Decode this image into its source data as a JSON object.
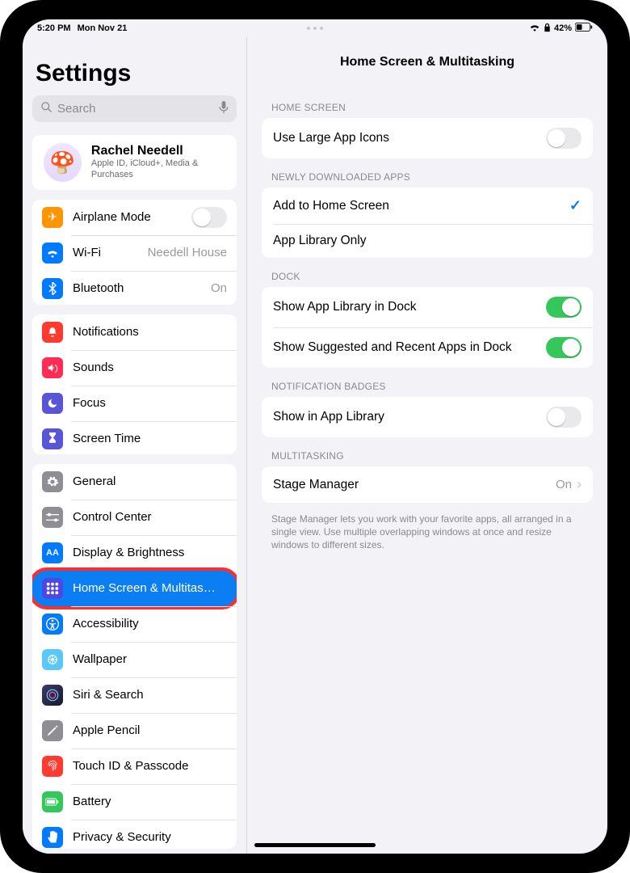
{
  "status": {
    "time": "5:20 PM",
    "date": "Mon Nov 21",
    "battery": "42%"
  },
  "sidebar": {
    "title": "Settings",
    "search_placeholder": "Search",
    "profile": {
      "name": "Rachel Needell",
      "sub": "Apple ID, iCloud+, Media & Purchases"
    },
    "g1": {
      "airplane": "Airplane Mode",
      "wifi": "Wi-Fi",
      "wifi_val": "Needell House",
      "bluetooth": "Bluetooth",
      "bluetooth_val": "On"
    },
    "g2": {
      "notifications": "Notifications",
      "sounds": "Sounds",
      "focus": "Focus",
      "screen_time": "Screen Time"
    },
    "g3": {
      "general": "General",
      "control_center": "Control Center",
      "display": "Display & Brightness",
      "home_screen": "Home Screen & Multitas…",
      "accessibility": "Accessibility",
      "wallpaper": "Wallpaper",
      "siri": "Siri & Search",
      "pencil": "Apple Pencil",
      "touchid": "Touch ID & Passcode",
      "battery": "Battery",
      "privacy": "Privacy & Security"
    }
  },
  "detail": {
    "title": "Home Screen & Multitasking",
    "home_screen_hdr": "HOME SCREEN",
    "large_icons": "Use Large App Icons",
    "newly_hdr": "NEWLY DOWNLOADED APPS",
    "add_home": "Add to Home Screen",
    "app_lib_only": "App Library Only",
    "dock_hdr": "DOCK",
    "show_lib_dock": "Show App Library in Dock",
    "show_suggested": "Show Suggested and Recent Apps in Dock",
    "badges_hdr": "NOTIFICATION BADGES",
    "show_in_lib": "Show in App Library",
    "multi_hdr": "MULTITASKING",
    "stage_mgr": "Stage Manager",
    "stage_val": "On",
    "stage_note": "Stage Manager lets you work with your favorite apps, all arranged in a single view. Use multiple overlapping windows at once and resize windows to different sizes."
  }
}
